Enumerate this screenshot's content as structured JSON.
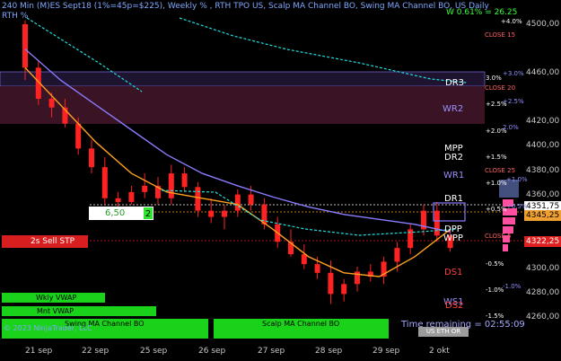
{
  "header": {
    "title": "240 Min (M)ES Sept18 (1%=45p=$225), Weekly % , RTH TPO US, Scalp MA Channel BO, Swing MA Channel BO, US Daily",
    "subtitle": "RTH %",
    "week_change": "W 0.61% = 26.25"
  },
  "y_axis": {
    "labels": [
      "4500,00",
      "4460,00",
      "4420,00",
      "4400,00",
      "4380,00",
      "4360,00",
      "4300,00",
      "4280,00",
      "4260,00"
    ],
    "price_tags": {
      "last": "4351,75",
      "mid": "4345,25",
      "current": "4322,25"
    }
  },
  "x_axis": {
    "labels": [
      "21 sep",
      "22 sep",
      "25 sep",
      "26 sep",
      "27 sep",
      "28 sep",
      "29 sep",
      "2 okt"
    ]
  },
  "percent_levels": {
    "left": [
      "+4.0%",
      "3.0%",
      "+2.5%",
      "+2.0%",
      "+1.5%",
      "+1.0%",
      "+0.5%",
      "-0.5%",
      "-1.0%",
      "-1.5%"
    ],
    "right": [
      "+3.0%",
      "+2.5%",
      "2.0%",
      "+1.0%",
      "+0.5%",
      "-1.0%"
    ]
  },
  "close_labels": [
    "CLOSE 15",
    "CLOSE 20",
    "CLOSE 25",
    "CLOSE 5"
  ],
  "tpo_levels": {
    "dr3": "DR3",
    "wr2": "WR2",
    "mpp": "MPP",
    "dr2": "DR2",
    "wr1": "WR1",
    "dr1": "DR1",
    "dpp": "DPP",
    "wpp": "WPP",
    "ds1": "DS1",
    "ws1": "WS1",
    "ds2": "DS2"
  },
  "position": {
    "value": "6,50",
    "qty": "2"
  },
  "strategy": {
    "sell_label": "2s  Sell STP"
  },
  "buttons": {
    "wkly_vwap": "Wkly VWAP",
    "mnt_vwap": "Mnt VWAP",
    "swing_ma": "Swing MA Channel BO",
    "scalp_ma": "Scalp MA Channel BO",
    "eth": "US ETH OR"
  },
  "footer": {
    "time_remaining": "Time remaining = 02:55:09",
    "copyright": "© 2023 NinjaTrader, LLC"
  },
  "colors": {
    "bull": "#ff2222",
    "bear": "#ff2222",
    "ma_orange": "#ffa020",
    "ma_purple": "#8a7cff",
    "cyan": "#20e0e0",
    "band": "#3a1a2a"
  },
  "chart_data": {
    "type": "candlestick",
    "title": "240 Min (M)ES Sept18 (1%=45p=$225), Weekly % , RTH TPO US, Scalp MA Channel BO, Swing MA Channel BO, US Daily",
    "x_labels": [
      "21 sep",
      "22 sep",
      "25 sep",
      "26 sep",
      "27 sep",
      "28 sep",
      "29 sep",
      "2 okt"
    ],
    "y_ticks": [
      4500,
      4460,
      4420,
      4400,
      4380,
      4360,
      4300,
      4280,
      4260
    ],
    "candles": [
      [
        4505,
        4508,
        4460,
        4470
      ],
      [
        4470,
        4475,
        4440,
        4445
      ],
      [
        4445,
        4450,
        4430,
        4438
      ],
      [
        4438,
        4445,
        4422,
        4425
      ],
      [
        4425,
        4430,
        4400,
        4405
      ],
      [
        4405,
        4412,
        4385,
        4390
      ],
      [
        4390,
        4398,
        4360,
        4365
      ],
      [
        4365,
        4370,
        4358,
        4362
      ],
      [
        4362,
        4375,
        4360,
        4370
      ],
      [
        4370,
        4385,
        4365,
        4375
      ],
      [
        4375,
        4382,
        4360,
        4365
      ],
      [
        4365,
        4392,
        4360,
        4385
      ],
      [
        4385,
        4390,
        4370,
        4374
      ],
      [
        4374,
        4378,
        4350,
        4355
      ],
      [
        4355,
        4365,
        4345,
        4350
      ],
      [
        4350,
        4360,
        4340,
        4355
      ],
      [
        4355,
        4372,
        4350,
        4368
      ],
      [
        4368,
        4375,
        4355,
        4360
      ],
      [
        4360,
        4365,
        4340,
        4344
      ],
      [
        4344,
        4350,
        4325,
        4330
      ],
      [
        4330,
        4340,
        4318,
        4320
      ],
      [
        4320,
        4328,
        4308,
        4312
      ],
      [
        4312,
        4318,
        4300,
        4305
      ],
      [
        4305,
        4315,
        4280,
        4288
      ],
      [
        4288,
        4300,
        4282,
        4296
      ],
      [
        4296,
        4310,
        4290,
        4306
      ],
      [
        4306,
        4312,
        4298,
        4302
      ],
      [
        4302,
        4318,
        4296,
        4314
      ],
      [
        4314,
        4330,
        4306,
        4325
      ],
      [
        4325,
        4345,
        4320,
        4340
      ],
      [
        4340,
        4360,
        4335,
        4355
      ],
      [
        4355,
        4362,
        4330,
        4335
      ],
      [
        4335,
        4342,
        4322,
        4325
      ]
    ],
    "series": [
      {
        "name": "Swing MA",
        "values": [
          4485,
          4460,
          4440,
          4420,
          4400,
          4385,
          4375,
          4366,
          4358,
          4352,
          4348,
          4344,
          4338
        ]
      },
      {
        "name": "Scalp MA",
        "values": [
          4470,
          4440,
          4410,
          4385,
          4370,
          4365,
          4360,
          4340,
          4318,
          4305,
          4302,
          4318,
          4340
        ]
      }
    ]
  }
}
